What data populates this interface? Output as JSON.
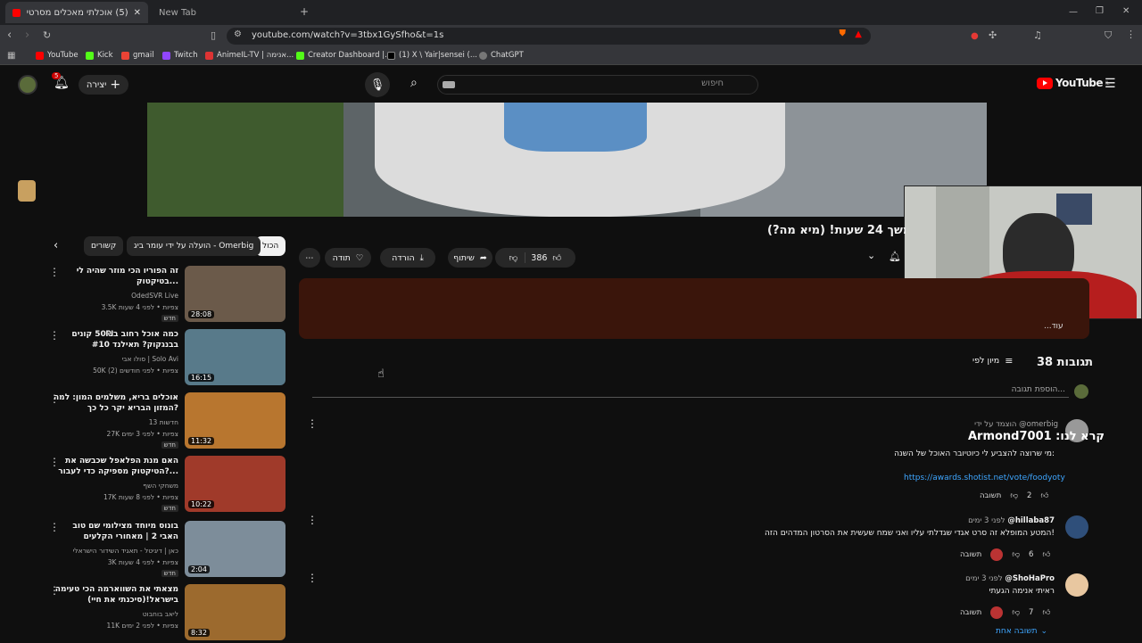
{
  "browser": {
    "tabs": [
      {
        "label": "(5) אוכלתי מאכלים מסרטים של ה",
        "active": true
      },
      {
        "label": "New Tab",
        "active": false
      }
    ],
    "new_tab_symbol": "+",
    "url": "youtube.com/watch?v=3tbx1GySfho&t=1s",
    "bookmarks": [
      "YouTube",
      "Kick",
      "gmail",
      "Twitch",
      "AnimeIL-TV | אנימה...",
      "Creator Dashboard |...",
      "(1) X \\ Yair|sensei (...",
      "ChatGPT"
    ],
    "bookmark_colors": [
      "#ff0000",
      "#53fc18",
      "#ea4335",
      "#9146ff",
      "#d33",
      "#53fc18",
      "#000",
      "#555"
    ]
  },
  "youtube": {
    "notification_count": "5",
    "create_label": "יצירה",
    "search_placeholder": "חיפוש",
    "logo_text": "YouTube",
    "logo_superscript": "IL"
  },
  "video": {
    "title": "משך 24 שעות! (מיא מה?)",
    "likes": "386",
    "actions": {
      "thanks": "תודה",
      "download": "הורדה",
      "share": "שיתוף"
    },
    "more_label": "...עוד"
  },
  "comments": {
    "count_label": "38 תגובות",
    "sort_label": "מיון לפי",
    "add_placeholder": "הוספת תגובה...",
    "items": [
      {
        "pinned_by": "הוצמד על ידי @omerbig",
        "author": "",
        "time": "",
        "overlay_name": "Armond7001 :קרא לנו",
        "text": "מי שרוצה להצביע לי כיוטיובר האוכל של השנה:",
        "link": "https://awards.shotist.net/vote/foodyoty",
        "likes": "",
        "reply": "תשובה"
      },
      {
        "pinned_by": "",
        "author": "@hillaba87",
        "time": "לפני 3 ימים",
        "text": "המטע המופלא זה סרט אגדי שגדלתי עליו ואני שמח שעשית את הסרטון המדהים הזה!",
        "likes": "6",
        "reply": "תשובה"
      },
      {
        "pinned_by": "",
        "author": "@ShoHaPro",
        "time": "לפני 3 ימים",
        "text": "ראיתי אנימה הגעתי",
        "likes": "7",
        "reply": "תשובה",
        "replies_label": "תשובה אחת"
      },
      {
        "likes": "2"
      }
    ]
  },
  "chips": [
    "הכול",
    "הועלה על ידי עומר ביג - Omerbig",
    "קשורים"
  ],
  "recommendations": [
    {
      "title": "זה הפוריו הכי מוזר שהיה לי בטיקטוק...",
      "channel": "OdedSVR Live",
      "meta": "3.5K צפיות • לפני 4 שעות",
      "badge": "חדש",
      "duration": "28:08",
      "color": "#6b5a4a"
    },
    {
      "title": "כמה אוכל רחוב ב50₪ קונים בבנגקוק? תאילנד #10",
      "channel": "סולו אבי | Solo Avi",
      "meta": "50K צפיות • לפני חודשים (2)",
      "badge": "",
      "duration": "16:15",
      "color": "#587a8a"
    },
    {
      "title": "אוכלים בריא, משלמים המון: למה המזון הבריא יקר כל כך?",
      "channel": "חדשות 13",
      "meta": "27K צפיות • לפני 3 ימים",
      "badge": "חדש",
      "duration": "11:32",
      "color": "#b8762f"
    },
    {
      "title": "האם מנת הפלאפל שכבשה את הטיקטוק מספיקה כדי לעבור?...",
      "channel": "משחקי השף",
      "meta": "17K צפיות • לפני 8 שעות",
      "badge": "חדש",
      "duration": "10:22",
      "color": "#a03a2a"
    },
    {
      "title": "בונוס מיוחד מצילומי שם טוב האבי 2 | מאחורי הקלעים",
      "channel": "כאן | דיגיטל - תאגיד השידור הישראלי",
      "meta": "3K צפיות • לפני 4 שעות",
      "badge": "חדש",
      "duration": "2:04",
      "color": "#7d8d9a"
    },
    {
      "title": "מצאתי את השווארמה הכי טעימה בישראל!(סיכנתי את חיי)",
      "channel": "ליאב בוחבוט",
      "meta": "11K צפיות • לפני 2 ימים",
      "badge": "",
      "duration": "8:32",
      "color": "#9c6a2e"
    }
  ],
  "colors": {
    "accent": "#ff0000",
    "link": "#3ea6ff",
    "description_bg": "#3a150b"
  }
}
